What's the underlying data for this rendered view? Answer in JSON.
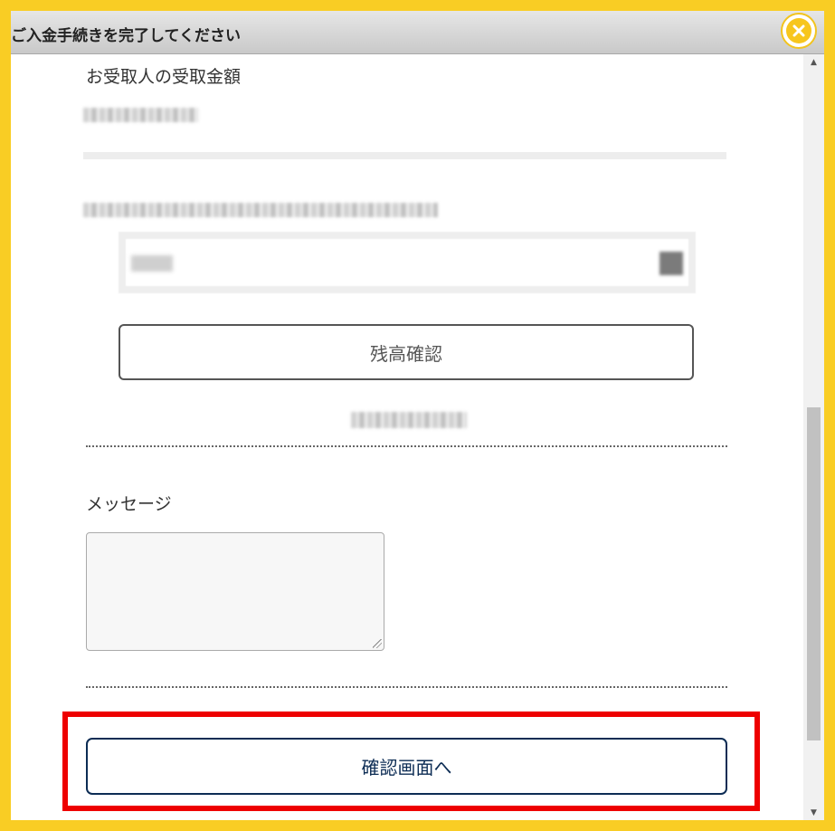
{
  "dialog": {
    "title": "ご入金手続きを完了してください",
    "close_glyph": "✕"
  },
  "form": {
    "receive_amount_label": "お受取人の受取金額",
    "balance_button": "残高確認",
    "message_label": "メッセージ",
    "message_value": "",
    "confirm_button": "確認画面へ"
  },
  "scrollbar": {
    "up": "▲",
    "down": "▼"
  },
  "colors": {
    "frame": "#f9cd24",
    "highlight": "#ee0000",
    "confirm_accent": "#0c2c54"
  },
  "icons": [
    "close-icon",
    "scroll-up-arrow-icon",
    "scroll-down-arrow-icon",
    "dropdown-icon"
  ]
}
